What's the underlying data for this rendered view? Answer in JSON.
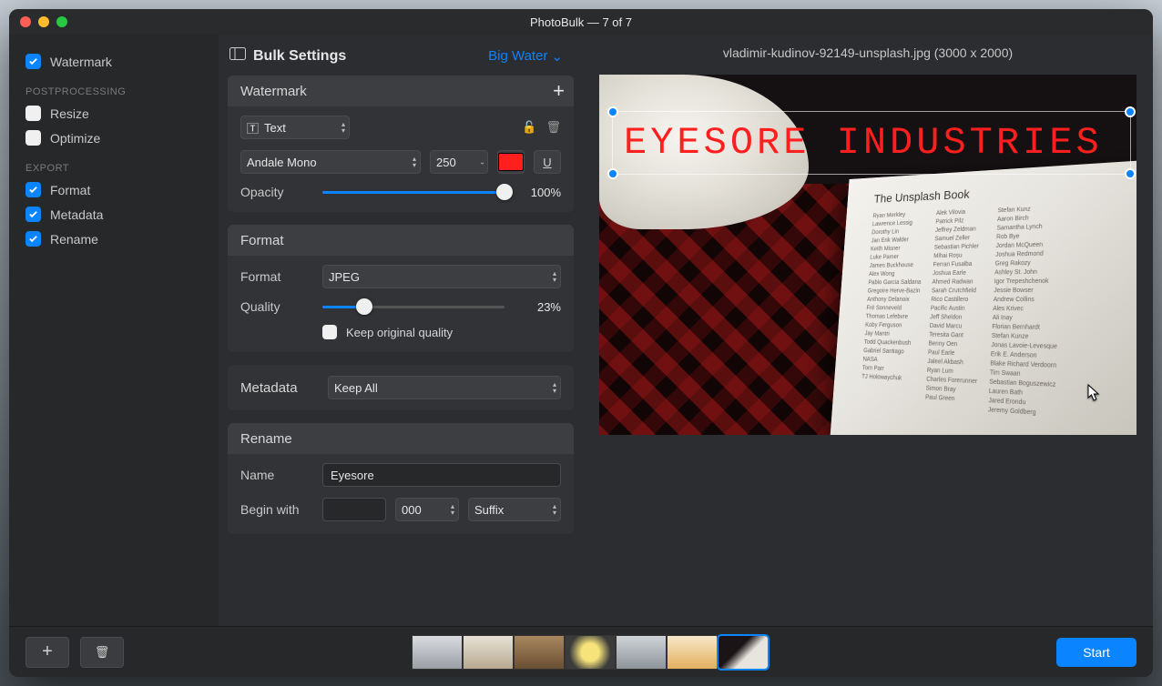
{
  "window": {
    "title": "PhotoBulk — 7 of 7"
  },
  "sidebar": {
    "watermark": {
      "label": "Watermark",
      "checked": true
    },
    "sections": {
      "postprocessing": {
        "label": "POSTPROCESSING",
        "resize": {
          "label": "Resize",
          "checked": false
        },
        "optimize": {
          "label": "Optimize",
          "checked": false
        }
      },
      "export": {
        "label": "EXPORT",
        "format": {
          "label": "Format",
          "checked": true
        },
        "metadata": {
          "label": "Metadata",
          "checked": true
        },
        "rename": {
          "label": "Rename",
          "checked": true
        }
      }
    }
  },
  "settings": {
    "title": "Bulk Settings",
    "preset": "Big Water",
    "watermark": {
      "header": "Watermark",
      "type": "Text",
      "font": "Andale Mono",
      "size": "250",
      "color": "#ff1f1f",
      "opacity_label": "Opacity",
      "opacity_pct": "100%",
      "opacity_value": 100
    },
    "format": {
      "header": "Format",
      "format_label": "Format",
      "format_value": "JPEG",
      "quality_label": "Quality",
      "quality_pct": "23%",
      "quality_value": 23,
      "keep_label": "Keep original quality",
      "keep_checked": false
    },
    "metadata": {
      "header": "Metadata",
      "value": "Keep All"
    },
    "rename": {
      "header": "Rename",
      "name_label": "Name",
      "name_value": "Eyesore",
      "begin_label": "Begin with",
      "begin_value": "",
      "counter": "000",
      "position": "Suffix"
    }
  },
  "preview": {
    "filename": "vladimir-kudinov-92149-unsplash.jpg (3000 x 2000)",
    "watermark_text": "EYESORE INDUSTRIES",
    "book_title": "The Unsplash Book",
    "credits": {
      "c1": [
        "Ryan Merkley",
        "Lawrence Lessig",
        "Dorothy Lin",
        "Jan Erik Walder",
        "Keith Misner",
        "Luke Pamer",
        "James Buckhouse",
        "Alex Wong",
        "Pablo Garcia Saldana",
        "Gregoire Herve-Bazin",
        "Anthony Delanoix",
        "Fré Sonneveld",
        "Thomas Lefebvre",
        "Koby Ferguson",
        "Jay Mantri",
        "Todd Quackenbush",
        "Gabriel Santiago",
        "NASA",
        "Tom Parr",
        "TJ Holowaychuk"
      ],
      "c2": [
        "Alek Vilovia",
        "Patrick Pilz",
        "Jeffrey Zeldman",
        "Samuel Zeller",
        "Sebastian Pichler",
        "Mihai Roșu",
        "Ferran Fusalba",
        "Joshua Earle",
        "Ahmed Radwan",
        "Sarah Crutchfield",
        "Rico Castillero",
        "Pacific Austin",
        "Jeff Sheldon",
        "David Marcu",
        "Teresita Gant",
        "Benny Oen",
        "Paul Earle",
        "Jaleel Akbash",
        "Ryan Lum",
        "Charles Forerunner",
        "Simon Bray",
        "Paul Green"
      ],
      "c3": [
        "Stefan Kunz",
        "Aaron Birch",
        "Samantha Lynch",
        "Rob Bye",
        "Jordan McQueen",
        "Joshua Redmond",
        "Greg Rakozy",
        "Ashley St. John",
        "Igor Trepeshchenok",
        "Jessie Bowser",
        "Andrew Collins",
        "Ales Krivec",
        "Ali Inay",
        "Florian Bernhardt",
        "Stefan Kunze",
        "Jonas Lavoie-Levesque",
        "Erik E. Anderson",
        "Blake Richard Verdoorn",
        "Tim Swaan",
        "Sebastian Boguszewicz",
        "Lauren Bath",
        "Jared Erondu",
        "Jeremy Goldberg"
      ]
    }
  },
  "footer": {
    "start": "Start"
  }
}
